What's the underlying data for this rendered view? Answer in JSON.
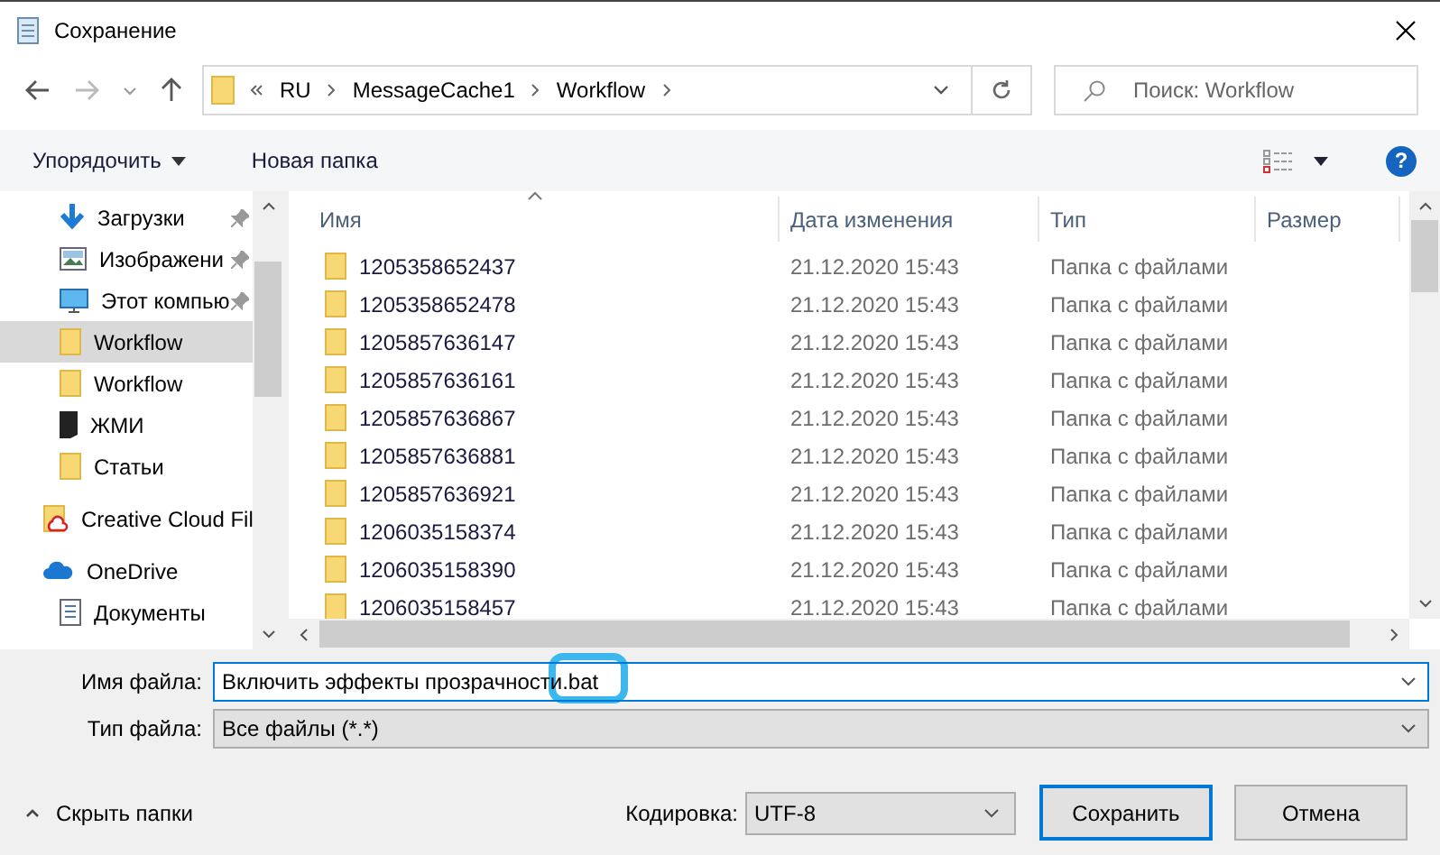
{
  "window": {
    "title": "Сохранение"
  },
  "nav": {
    "path": [
      "RU",
      "MessageCache1",
      "Workflow"
    ],
    "search": {
      "placeholder": "Поиск: Workflow"
    }
  },
  "toolbar": {
    "organize": "Упорядочить",
    "new_folder": "Новая папка",
    "help": "?"
  },
  "sidebar": {
    "quick_access": [
      {
        "label": "Загрузки",
        "kind": "download",
        "pinned": true,
        "selected": false
      },
      {
        "label": "Изображени",
        "kind": "pictures",
        "pinned": true,
        "selected": false
      },
      {
        "label": "Этот компью",
        "kind": "computer",
        "pinned": true,
        "selected": false
      },
      {
        "label": "Workflow",
        "kind": "folder",
        "pinned": false,
        "selected": true
      },
      {
        "label": "Workflow",
        "kind": "folder",
        "pinned": false,
        "selected": false
      },
      {
        "label": "ЖМИ",
        "kind": "dark-folder",
        "pinned": false,
        "selected": false
      },
      {
        "label": "Статьи",
        "kind": "folder",
        "pinned": false,
        "selected": false
      }
    ],
    "roots": [
      {
        "label": "Creative Cloud Fil",
        "kind": "creative-cloud"
      },
      {
        "label": "OneDrive",
        "kind": "onedrive",
        "children": [
          {
            "label": "Документы",
            "kind": "documents"
          }
        ]
      }
    ]
  },
  "table": {
    "columns": [
      {
        "label": "Имя",
        "sorted": true
      },
      {
        "label": "Дата изменения",
        "sorted": false
      },
      {
        "label": "Тип",
        "sorted": false
      },
      {
        "label": "Размер",
        "sorted": false
      }
    ],
    "rows": [
      {
        "name": "1205358652437",
        "date": "21.12.2020 15:43",
        "type": "Папка с файлами"
      },
      {
        "name": "1205358652478",
        "date": "21.12.2020 15:43",
        "type": "Папка с файлами"
      },
      {
        "name": "1205857636147",
        "date": "21.12.2020 15:43",
        "type": "Папка с файлами"
      },
      {
        "name": "1205857636161",
        "date": "21.12.2020 15:43",
        "type": "Папка с файлами"
      },
      {
        "name": "1205857636867",
        "date": "21.12.2020 15:43",
        "type": "Папка с файлами"
      },
      {
        "name": "1205857636881",
        "date": "21.12.2020 15:43",
        "type": "Папка с файлами"
      },
      {
        "name": "1205857636921",
        "date": "21.12.2020 15:43",
        "type": "Папка с файлами"
      },
      {
        "name": "1206035158374",
        "date": "21.12.2020 15:43",
        "type": "Папка с файлами"
      },
      {
        "name": "1206035158390",
        "date": "21.12.2020 15:43",
        "type": "Папка с файлами"
      },
      {
        "name": "1206035158457",
        "date": "21.12.2020 15:43",
        "type": "Папка с файлами"
      }
    ]
  },
  "form": {
    "filename": {
      "label": "Имя файла:",
      "value": "Включить эффекты прозрачности.bat",
      "highlighted": true
    },
    "filetype": {
      "label": "Тип файла:",
      "value": "Все файлы  (*.*)"
    },
    "hide_folders": "Скрыть папки",
    "encoding": {
      "label": "Кодировка:",
      "value": "UTF-8"
    },
    "buttons": [
      {
        "label": "Сохранить",
        "default": true
      },
      {
        "label": "Отмена",
        "default": false
      }
    ]
  }
}
